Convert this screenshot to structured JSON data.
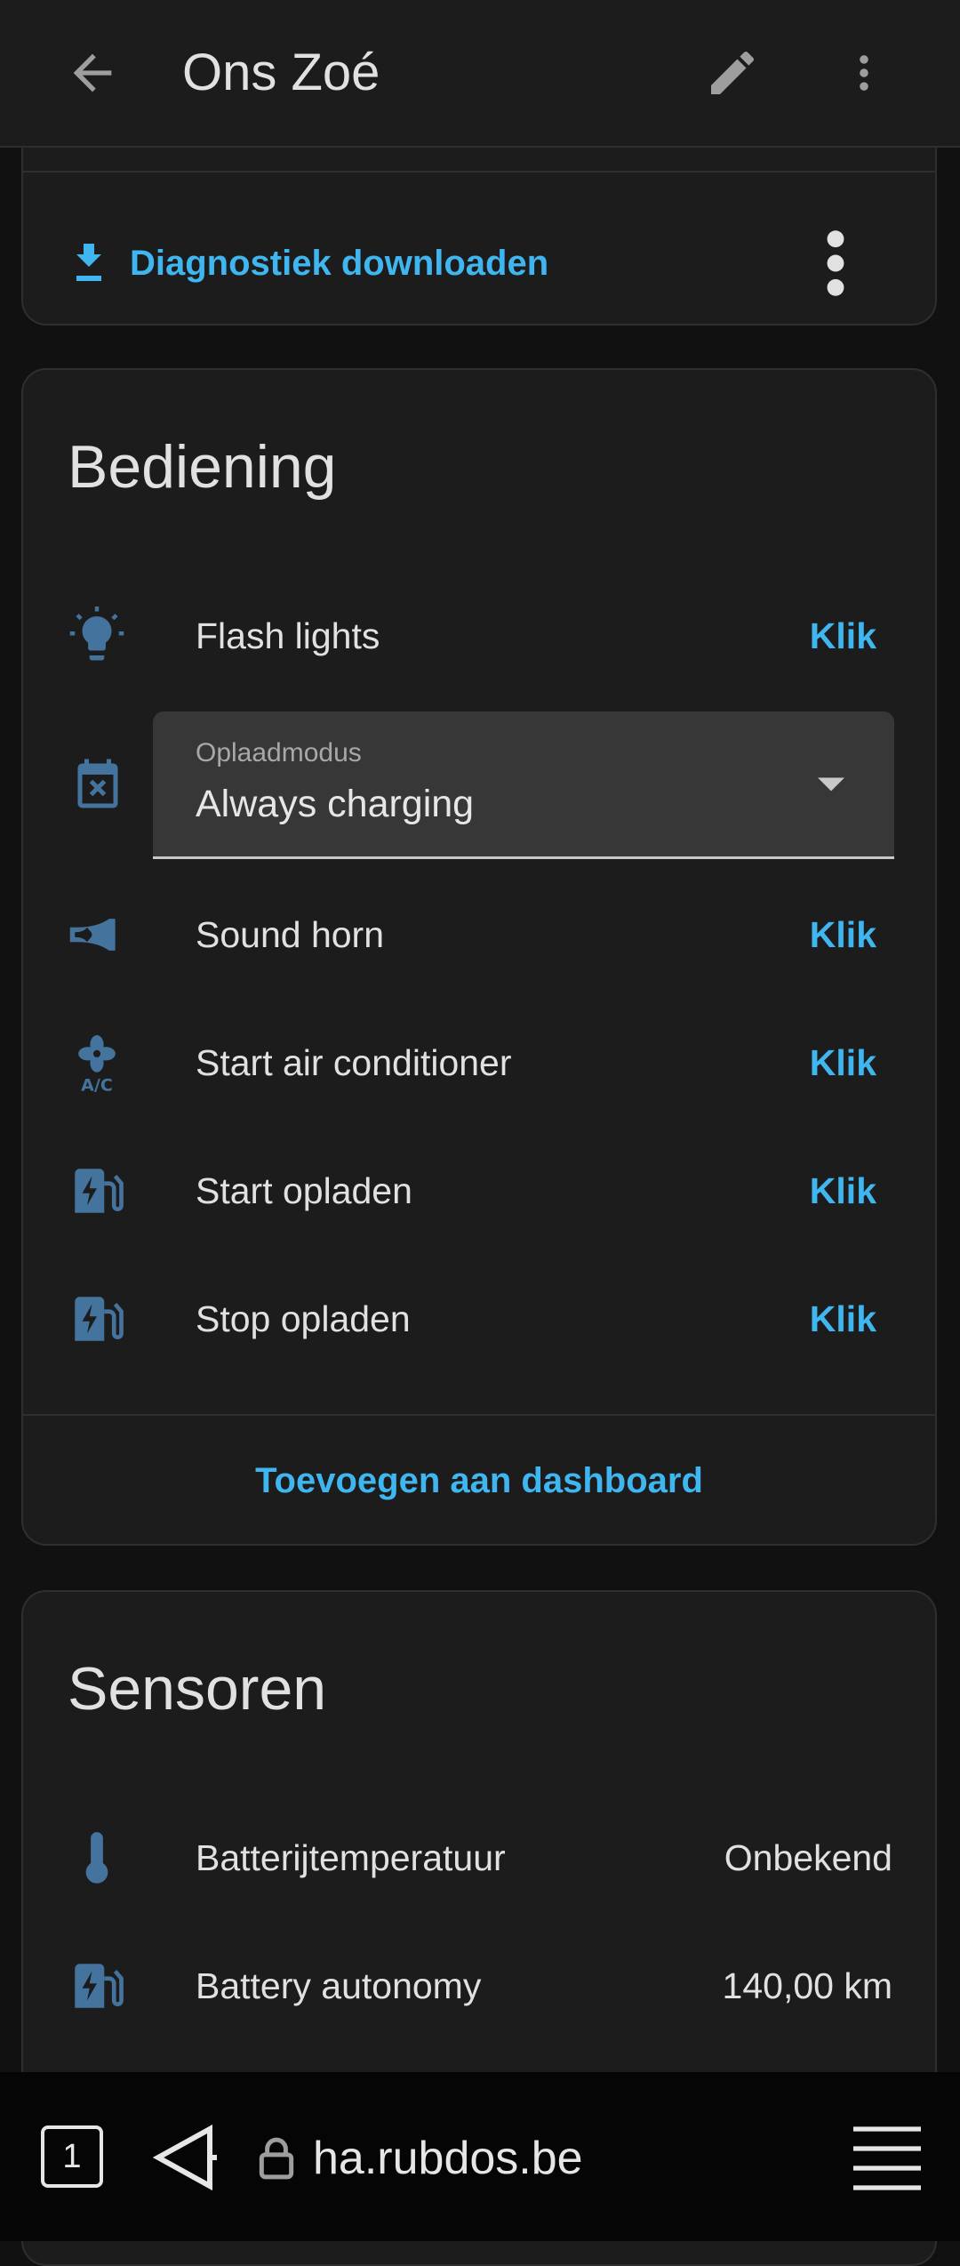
{
  "header": {
    "title": "Ons Zoé",
    "back_icon": "arrow-left-icon",
    "edit_icon": "pencil-icon",
    "more_icon": "dots-vertical-icon"
  },
  "diagnostics": {
    "label": "Diagnostiek downloaden",
    "icon": "download-icon"
  },
  "controls": {
    "title": "Bediening",
    "items": [
      {
        "label": "Flash lights",
        "action": "Klik",
        "icon": "lightbulb-icon"
      },
      {
        "label": "Sound horn",
        "action": "Klik",
        "icon": "horn-icon"
      },
      {
        "label": "Start air conditioner",
        "action": "Klik",
        "icon": "air-conditioner-icon"
      },
      {
        "label": "Start opladen",
        "action": "Klik",
        "icon": "ev-station-icon"
      },
      {
        "label": "Stop opladen",
        "action": "Klik",
        "icon": "ev-station-icon"
      }
    ],
    "select": {
      "label": "Oplaadmodus",
      "value": "Always charging",
      "icon": "calendar-remove-icon"
    },
    "add_to_dashboard": "Toevoegen aan dashboard"
  },
  "sensors": {
    "title": "Sensoren",
    "items": [
      {
        "label": "Batterijtemperatuur",
        "value": "Onbekend",
        "icon": "thermometer-icon"
      },
      {
        "label": "Battery autonomy",
        "value": "140,00 km",
        "icon": "ev-station-icon"
      }
    ]
  },
  "browser": {
    "tab_count": "1",
    "url": "ha.rubdos.be"
  },
  "colors": {
    "accent": "#3fb6f0",
    "icon": "#44739e",
    "card": "#1c1c1c",
    "background": "#111111"
  }
}
